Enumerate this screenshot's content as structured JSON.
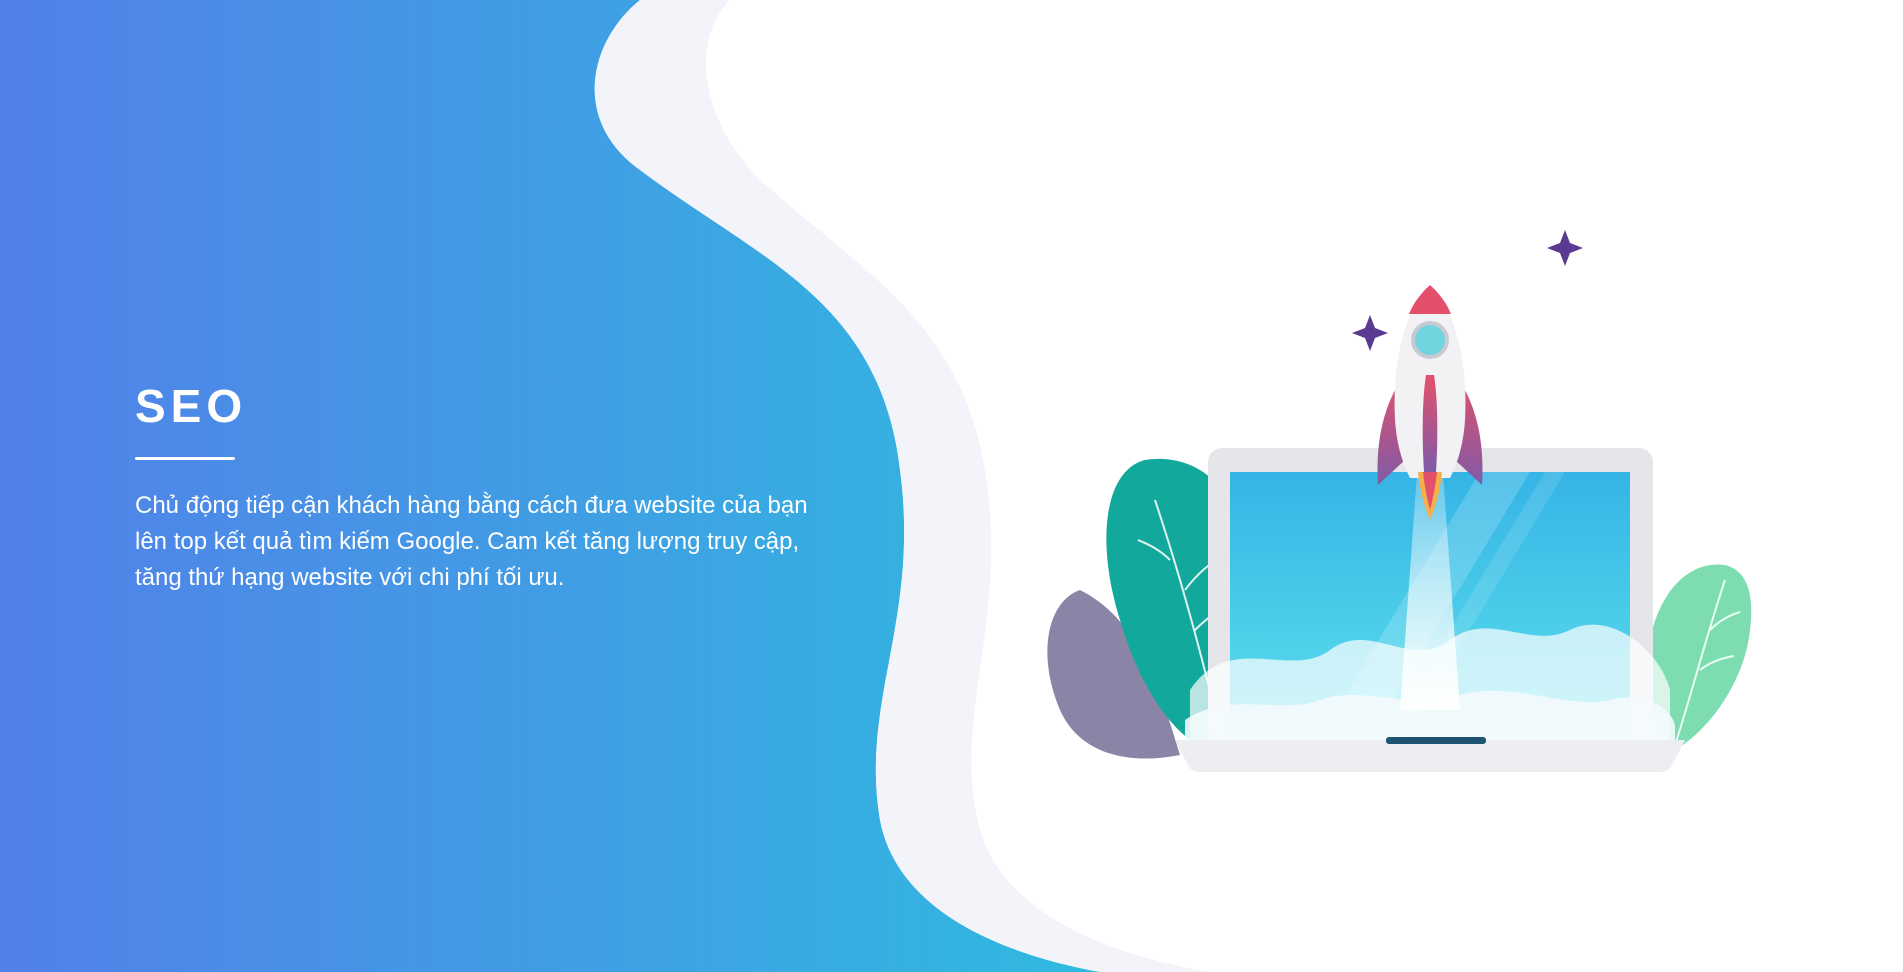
{
  "hero": {
    "title": "SEO",
    "description": "Chủ động tiếp cận khách hàng bằng cách đưa website của bạn lên top kết quả tìm kiếm Google. Cam kết tăng lượng truy cập, tăng thứ hạng website với chi phí tối ưu."
  },
  "colors": {
    "gradient_start": "#5280e9",
    "gradient_end": "#2fbadf",
    "star": "#5b3a92",
    "leaf_teal": "#12a99c",
    "leaf_mint": "#7dddb0",
    "leaf_purple": "#8a84a6",
    "screen": "#4fd0ea",
    "rocket_flame": "#e4506b"
  },
  "illustration": {
    "icons": [
      "rocket-icon",
      "laptop-icon",
      "star-icon",
      "leaf-icon",
      "cloud-icon"
    ]
  }
}
